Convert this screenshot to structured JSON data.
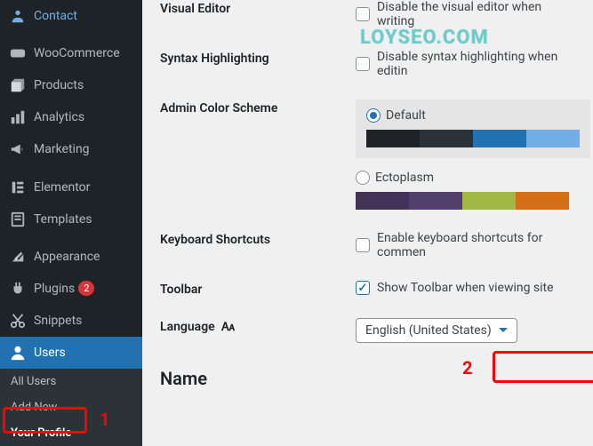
{
  "watermark": "LOYSEO.COM",
  "sidebar": {
    "items": [
      {
        "label": "Contact",
        "icon": "contact"
      },
      {
        "label": "WooCommerce",
        "icon": "woo"
      },
      {
        "label": "Products",
        "icon": "products"
      },
      {
        "label": "Analytics",
        "icon": "analytics"
      },
      {
        "label": "Marketing",
        "icon": "marketing"
      },
      {
        "label": "Elementor",
        "icon": "elementor"
      },
      {
        "label": "Templates",
        "icon": "templates"
      },
      {
        "label": "Appearance",
        "icon": "appearance"
      },
      {
        "label": "Plugins",
        "icon": "plugins",
        "badge": "2"
      },
      {
        "label": "Snippets",
        "icon": "snippets"
      },
      {
        "label": "Users",
        "icon": "users",
        "active": true
      }
    ],
    "submenu": [
      {
        "label": "All Users"
      },
      {
        "label": "Add New"
      },
      {
        "label": "Your Profile",
        "current": true
      }
    ]
  },
  "profile": {
    "visual_editor": {
      "label": "Visual Editor",
      "checkbox_label": "Disable the visual editor when writing"
    },
    "syntax": {
      "label": "Syntax Highlighting",
      "checkbox_label": "Disable syntax highlighting when editin"
    },
    "color_scheme": {
      "label": "Admin Color Scheme",
      "options": [
        {
          "name": "Default",
          "selected": true,
          "colors": [
            "#1d2327",
            "#2c3338",
            "#2271b1",
            "#72aee6"
          ]
        },
        {
          "name": "Ectoplasm",
          "selected": false,
          "colors": [
            "#413256",
            "#523f6d",
            "#a3b745",
            "#d46f15"
          ]
        }
      ]
    },
    "shortcuts": {
      "label": "Keyboard Shortcuts",
      "checkbox_label": "Enable keyboard shortcuts for commen"
    },
    "toolbar": {
      "label": "Toolbar",
      "checkbox_label": "Show Toolbar when viewing site",
      "checked": true
    },
    "language": {
      "label": "Language",
      "value": "English (United States)"
    },
    "name_heading": "Name"
  },
  "markers": {
    "one": "1",
    "two": "2"
  }
}
